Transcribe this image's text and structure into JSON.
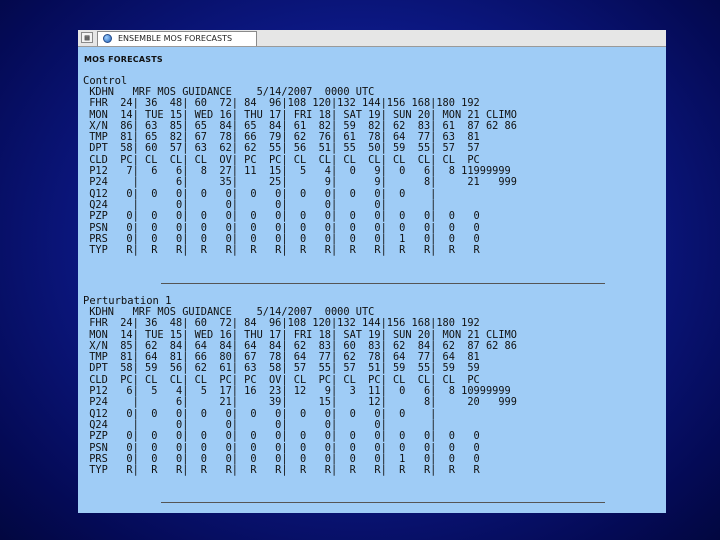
{
  "window": {
    "tab_title": "ENSEMBLE MOS FORECASTS",
    "page_header": "MOS FORECASTS"
  },
  "sections": [
    {
      "title": "Control",
      "lines": [
        " KDHN   MRF MOS GUIDANCE    5/14/2007  0000 UTC",
        " FHR  24| 36  48| 60  72| 84  96|108 120|132 144|156 168|180 192",
        " MON  14| TUE 15| WED 16| THU 17| FRI 18| SAT 19| SUN 20| MON 21 CLIMO",
        " X/N  86| 63  85| 65  84| 65  84| 61  82| 59  82| 62  83| 61  87 62 86",
        " TMP  81| 65  82| 67  78| 66  79| 62  76| 61  78| 64  77| 63  81",
        " DPT  58| 60  57| 63  62| 62  55| 56  51| 55  50| 59  55| 57  57",
        " CLD  PC| CL  CL| CL  OV| PC  PC| CL  CL| CL  CL| CL  CL| CL  PC",
        " P12   7|  6   6|  8  27| 11  15|  5   4|  0   9|  0   6|  8 11999999",
        " P24    |      6|     35|     25|      9|      9|      8|     21   999",
        " Q12   0|  0   0|  0   0|  0   0|  0   0|  0   0|  0    |",
        " Q24    |      0|      0|      0|      0|      0|       |",
        " PZP   0|  0   0|  0   0|  0   0|  0   0|  0   0|  0   0|  0   0",
        " PSN   0|  0   0|  0   0|  0   0|  0   0|  0   0|  0   0|  0   0",
        " PRS   0|  0   0|  0   0|  0   0|  0   0|  0   0|  1   0|  0   0",
        " TYP   R|  R   R|  R   R|  R   R|  R   R|  R   R|  R   R|  R   R"
      ]
    },
    {
      "title": "Perturbation 1",
      "lines": [
        " KDHN   MRF MOS GUIDANCE    5/14/2007  0000 UTC",
        " FHR  24| 36  48| 60  72| 84  96|108 120|132 144|156 168|180 192",
        " MON  14| TUE 15| WED 16| THU 17| FRI 18| SAT 19| SUN 20| MON 21 CLIMO",
        " X/N  85| 62  84| 64  84| 64  84| 62  83| 60  83| 62  84| 62  87 62 86",
        " TMP  81| 64  81| 66  80| 67  78| 64  77| 62  78| 64  77| 64  81",
        " DPT  58| 59  56| 62  61| 63  58| 57  55| 57  51| 59  55| 59  59",
        " CLD  PC| CL  CL| CL  PC| PC  OV| CL  PC| CL  PC| CL  CL| CL  PC",
        " P12   6|  5   4|  5  17| 16  23| 12   9|  3  11|  0   6|  8 10999999",
        " P24    |      6|     21|     39|     15|     12|      8|     20   999",
        " Q12   0|  0   0|  0   0|  0   0|  0   0|  0   0|  0    |",
        " Q24    |      0|      0|      0|      0|      0|       |",
        " PZP   0|  0   0|  0   0|  0   0|  0   0|  0   0|  0   0|  0   0",
        " PSN   0|  0   0|  0   0|  0   0|  0   0|  0   0|  0   0|  0   0",
        " PRS   0|  0   0|  0   0|  0   0|  0   0|  0   0|  1   0|  0   0",
        " TYP   R|  R   R|  R   R|  R   R|  R   R|  R   R|  R   R|  R   R"
      ]
    }
  ]
}
